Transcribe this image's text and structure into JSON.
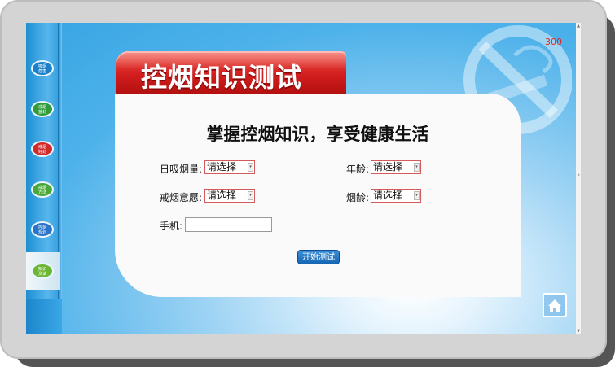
{
  "header": {
    "title": "控烟知识测试",
    "counter": "300"
  },
  "sidebar": {
    "items": [
      {
        "label": "吸烟\n危害",
        "color": "#1b7fc9"
      },
      {
        "label": "戒烟\n益处",
        "color": "#2f9b3a"
      },
      {
        "label": "戒烟\n好处",
        "color": "#d12a2a"
      },
      {
        "label": "戒烟\n方法",
        "color": "#4aa83a"
      },
      {
        "label": "控烟\n规划",
        "color": "#2b74c7"
      },
      {
        "label": "知识\n测试",
        "color": "#6bb632"
      }
    ]
  },
  "form": {
    "heading": "掌握控烟知识，享受健康生活",
    "daily_smoke_label": "日吸烟量:",
    "daily_smoke_value": "请选择",
    "age_label": "年龄:",
    "age_value": "请选择",
    "quit_will_label": "戒烟意愿:",
    "quit_will_value": "请选择",
    "smoke_years_label": "烟龄:",
    "smoke_years_value": "请选择",
    "phone_label": "手机:",
    "phone_value": "",
    "start_button": "开始测试"
  },
  "colors": {
    "accent_red": "#d21e1e",
    "screen_blue": "#36a4e3",
    "button_blue": "#1565b4"
  },
  "icons": {
    "no_smoking": "no-smoking-icon",
    "home": "home-icon",
    "dropdown": "chevron-down-icon"
  }
}
